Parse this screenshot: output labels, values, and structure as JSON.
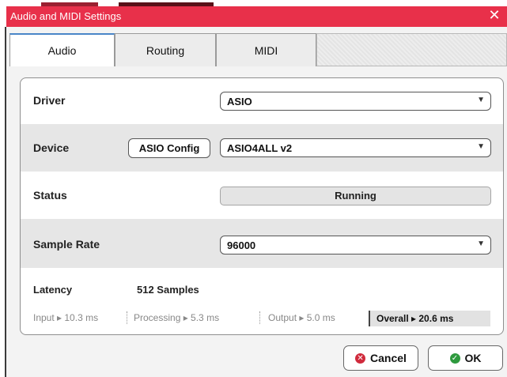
{
  "window": {
    "title": "Audio and MIDI Settings",
    "close_glyph": "✕"
  },
  "tabs": [
    {
      "label": "Audio",
      "active": true
    },
    {
      "label": "Routing",
      "active": false
    },
    {
      "label": "MIDI",
      "active": false
    }
  ],
  "audio": {
    "driver": {
      "label": "Driver",
      "value": "ASIO"
    },
    "device": {
      "label": "Device",
      "config_button": "ASIO Config",
      "value": "ASIO4ALL v2"
    },
    "status": {
      "label": "Status",
      "value": "Running"
    },
    "sample_rate": {
      "label": "Sample Rate",
      "value": "96000"
    },
    "latency": {
      "label": "Latency",
      "value": "512 Samples",
      "input": "Input ▸ 10.3 ms",
      "processing": "Processing  ▸ 5.3 ms",
      "output": "Output ▸ 5.0 ms",
      "overall": "Overall  ▸ 20.6 ms"
    }
  },
  "footer": {
    "cancel_label": "Cancel",
    "ok_label": "OK"
  },
  "icons": {
    "dropdown": "chevron-down-icon",
    "cancel": "cancel-icon",
    "ok": "check-icon"
  },
  "colors": {
    "titlebar": "#e8304a",
    "active_tab_accent": "#4a86c8",
    "cancel_icon": "#d02a3c",
    "ok_icon": "#2e9a3e"
  }
}
